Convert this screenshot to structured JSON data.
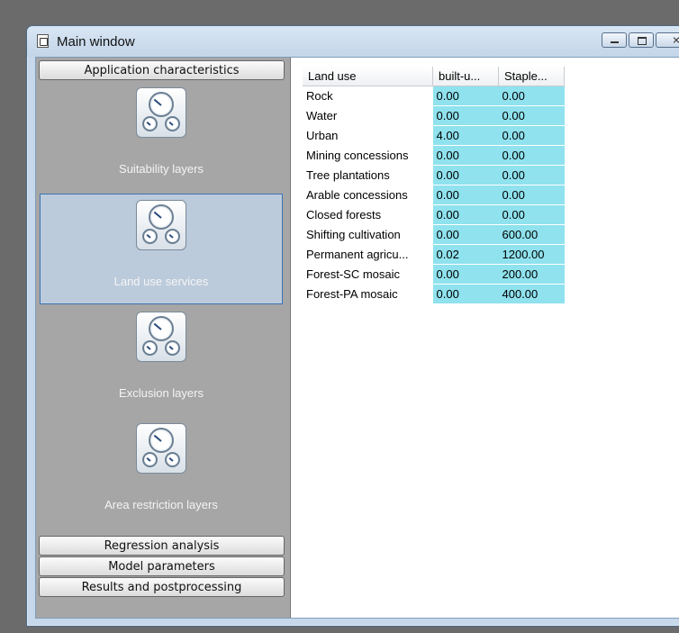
{
  "window": {
    "title": "Main window",
    "buttons": {
      "minimize": "minimize",
      "maximize": "maximize",
      "close": "close"
    }
  },
  "nav": {
    "top_header": "Application characteristics",
    "items": [
      {
        "label": "Suitability layers",
        "icon": "dials-icon",
        "selected": false
      },
      {
        "label": "Land use services",
        "icon": "dials-icon",
        "selected": true
      },
      {
        "label": "Exclusion layers",
        "icon": "dials-icon",
        "selected": false
      },
      {
        "label": "Area restriction layers",
        "icon": "dials-icon",
        "selected": false
      }
    ],
    "bottom_headers": [
      "Regression analysis",
      "Model parameters",
      "Results and postprocessing"
    ]
  },
  "grid": {
    "columns": [
      "Land use",
      "built-u...",
      "Staple..."
    ],
    "rows": [
      [
        "Rock",
        "0.00",
        "0.00"
      ],
      [
        "Water",
        "0.00",
        "0.00"
      ],
      [
        "Urban",
        "4.00",
        "0.00"
      ],
      [
        "Mining concessions",
        "0.00",
        "0.00"
      ],
      [
        "Tree plantations",
        "0.00",
        "0.00"
      ],
      [
        "Arable concessions",
        "0.00",
        "0.00"
      ],
      [
        "Closed forests",
        "0.00",
        "0.00"
      ],
      [
        "Shifting cultivation",
        "0.00",
        "600.00"
      ],
      [
        "Permanent agricu...",
        "0.02",
        "1200.00"
      ],
      [
        "Forest-SC mosaic",
        "0.00",
        "200.00"
      ],
      [
        "Forest-PA mosaic",
        "0.00",
        "400.00"
      ]
    ]
  },
  "colors": {
    "cell_highlight": "#8fe2ee",
    "nav_background": "#a6a6a6",
    "selected_item": "#bccbdb"
  }
}
